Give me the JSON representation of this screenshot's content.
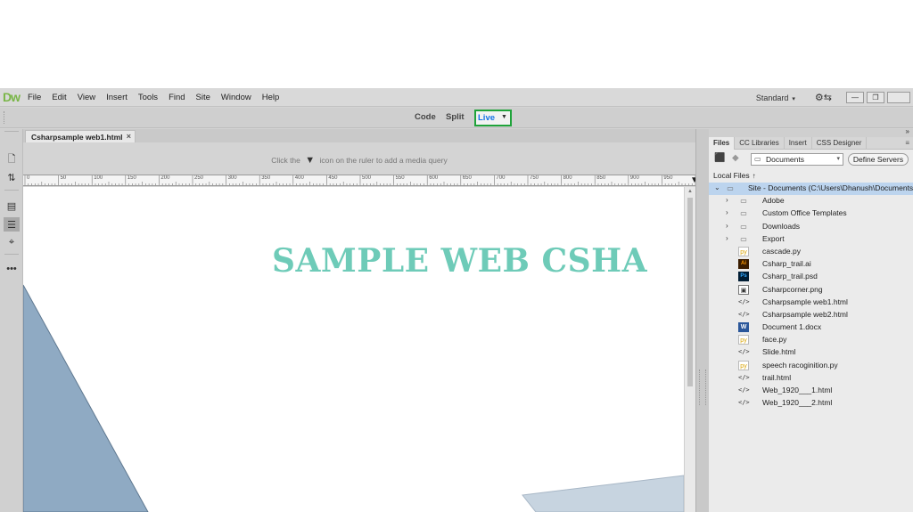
{
  "app": {
    "logo": "Dw",
    "menu": [
      "File",
      "Edit",
      "View",
      "Insert",
      "Tools",
      "Find",
      "Site",
      "Window",
      "Help"
    ],
    "workspace": "Standard",
    "accent": "#1fa33a"
  },
  "viewbar": {
    "code": "Code",
    "split": "Split",
    "live": "Live"
  },
  "document": {
    "tab_title": "Csharpsample web1.html",
    "mq_hint_before": "Click the",
    "mq_hint_after": "icon on the ruler to add a media query",
    "ruler_ticks": [
      "0",
      "50",
      "100",
      "150",
      "200",
      "250",
      "300",
      "350",
      "400",
      "450",
      "500",
      "550",
      "600",
      "650",
      "700",
      "750",
      "800",
      "850",
      "900",
      "950"
    ],
    "headline": "SAMPLE WEB CSHA",
    "headline_color": "#6ecbb8"
  },
  "panel": {
    "tabs": [
      "Files",
      "CC Libraries",
      "Insert",
      "CSS Designer"
    ],
    "site_select": "Documents",
    "define_servers": "Define Servers",
    "local_files": "Local Files",
    "root": "Site - Documents (C:\\Users\\Dhanush\\Documents)",
    "files": [
      {
        "name": "Adobe",
        "icon": "folder-icon",
        "type": "folder"
      },
      {
        "name": "Custom Office Templates",
        "icon": "folder-icon",
        "type": "folder"
      },
      {
        "name": "Downloads",
        "icon": "folder-icon",
        "type": "folder"
      },
      {
        "name": "Export",
        "icon": "folder-icon",
        "type": "folder"
      },
      {
        "name": "cascade.py",
        "icon": "python-file-icon",
        "type": "py"
      },
      {
        "name": "Csharp_trail.ai",
        "icon": "illustrator-file-icon",
        "type": "ai"
      },
      {
        "name": "Csharp_trail.psd",
        "icon": "photoshop-file-icon",
        "type": "ps"
      },
      {
        "name": "Csharpcorner.png",
        "icon": "image-file-icon",
        "type": "img"
      },
      {
        "name": "Csharpsample web1.html",
        "icon": "code-file-icon",
        "type": "code"
      },
      {
        "name": "Csharpsample web2.html",
        "icon": "code-file-icon",
        "type": "code"
      },
      {
        "name": "Document 1.docx",
        "icon": "word-file-icon",
        "type": "doc"
      },
      {
        "name": "face.py",
        "icon": "python-file-icon",
        "type": "py"
      },
      {
        "name": "Slide.html",
        "icon": "code-file-icon",
        "type": "code"
      },
      {
        "name": "speech racoginition.py",
        "icon": "python-file-icon",
        "type": "py"
      },
      {
        "name": "trail.html",
        "icon": "code-file-icon",
        "type": "code"
      },
      {
        "name": "Web_1920___1.html",
        "icon": "code-file-icon",
        "type": "code"
      },
      {
        "name": "Web_1920___2.html",
        "icon": "code-file-icon",
        "type": "code"
      }
    ]
  }
}
